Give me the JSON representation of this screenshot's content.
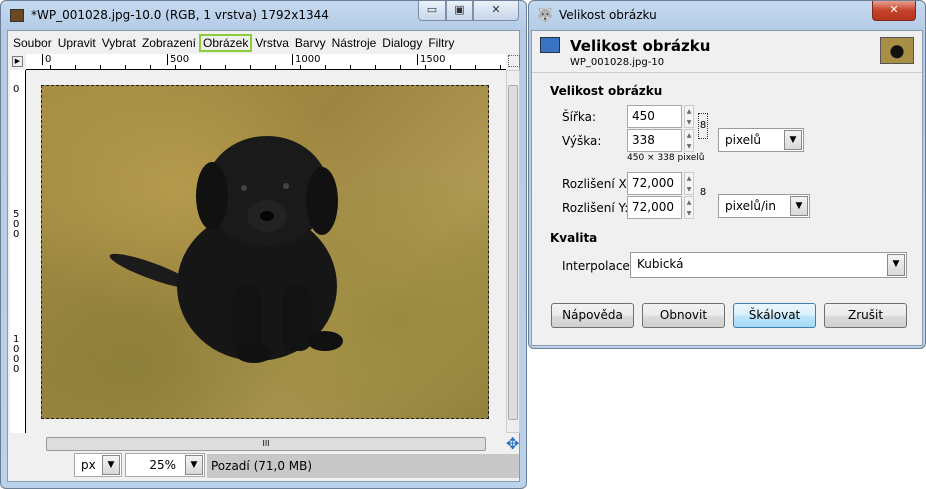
{
  "gimp": {
    "title": "*WP_001028.jpg-10.0 (RGB, 1 vrstva) 1792x1344",
    "menu": [
      "Soubor",
      "Upravit",
      "Vybrat",
      "Zobrazení",
      "Obrázek",
      "Vrstva",
      "Barvy",
      "Nástroje",
      "Dialogy",
      "Filtry"
    ],
    "ruler_h": [
      "0",
      "500",
      "1000",
      "1500"
    ],
    "ruler_v": [
      "0",
      "5\n0\n0",
      "1\n0\n0\n0"
    ],
    "unit": "px",
    "zoom": "25%",
    "status": "Pozadí (71,0 MB)"
  },
  "dialog": {
    "title": "Velikost obrázku",
    "header_title": "Velikost obrázku",
    "header_sub": "WP_001028.jpg-10",
    "section_size": "Velikost obrázku",
    "width_label": "Šířka:",
    "width": "450",
    "height_label": "Výška:",
    "height": "338",
    "size_note": "450 × 338 pixelů",
    "size_unit": "pixelů",
    "resx_label": "Rozlišení X:",
    "resx": "72,000",
    "resy_label": "Rozlišení Y:",
    "resy": "72,000",
    "res_unit": "pixelů/in",
    "section_quality": "Kvalita",
    "interp_label": "Interpolace:",
    "interp": "Kubická",
    "buttons": {
      "help": "Nápověda",
      "reset": "Obnovit",
      "scale": "Škálovat",
      "cancel": "Zrušit"
    }
  }
}
